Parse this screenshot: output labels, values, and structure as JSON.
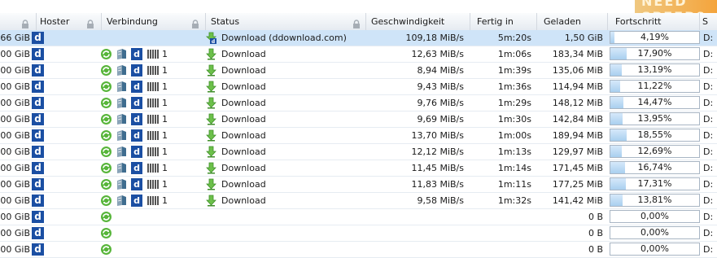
{
  "banner_text": "NEED SPEED?",
  "columns": {
    "hoster": "Hoster",
    "verbindung": "Verbindung",
    "status": "Status",
    "geschwindigkeit": "Geschwindigkeit",
    "fertig_in": "Fertig in",
    "geladen": "Geladen",
    "fortschritt": "Fortschritt",
    "last": "S"
  },
  "rows": [
    {
      "size": "66 GiB",
      "hoster": "d",
      "connections": "",
      "status": "Download (ddownload.com)",
      "speed": "109,18 MiB/s",
      "eta": "5m:20s",
      "loaded": "1,50 GiB",
      "progress": "4,19%",
      "progress_value": 4.19,
      "last": "D:",
      "selected": true
    },
    {
      "size": "00 GiB",
      "hoster": "d",
      "connections": "1",
      "status": "Download",
      "speed": "12,63 MiB/s",
      "eta": "1m:06s",
      "loaded": "183,34 MiB",
      "progress": "17,90%",
      "progress_value": 17.9,
      "last": "D:"
    },
    {
      "size": "00 GiB",
      "hoster": "d",
      "connections": "1",
      "status": "Download",
      "speed": "8,94 MiB/s",
      "eta": "1m:39s",
      "loaded": "135,06 MiB",
      "progress": "13,19%",
      "progress_value": 13.19,
      "last": "D:"
    },
    {
      "size": "00 GiB",
      "hoster": "d",
      "connections": "1",
      "status": "Download",
      "speed": "9,43 MiB/s",
      "eta": "1m:36s",
      "loaded": "114,94 MiB",
      "progress": "11,22%",
      "progress_value": 11.22,
      "last": "D:"
    },
    {
      "size": "00 GiB",
      "hoster": "d",
      "connections": "1",
      "status": "Download",
      "speed": "9,76 MiB/s",
      "eta": "1m:29s",
      "loaded": "148,12 MiB",
      "progress": "14,47%",
      "progress_value": 14.47,
      "last": "D:"
    },
    {
      "size": "00 GiB",
      "hoster": "d",
      "connections": "1",
      "status": "Download",
      "speed": "9,69 MiB/s",
      "eta": "1m:30s",
      "loaded": "142,84 MiB",
      "progress": "13,95%",
      "progress_value": 13.95,
      "last": "D:"
    },
    {
      "size": "00 GiB",
      "hoster": "d",
      "connections": "1",
      "status": "Download",
      "speed": "13,70 MiB/s",
      "eta": "1m:00s",
      "loaded": "189,94 MiB",
      "progress": "18,55%",
      "progress_value": 18.55,
      "last": "D:"
    },
    {
      "size": "00 GiB",
      "hoster": "d",
      "connections": "1",
      "status": "Download",
      "speed": "12,12 MiB/s",
      "eta": "1m:13s",
      "loaded": "129,97 MiB",
      "progress": "12,69%",
      "progress_value": 12.69,
      "last": "D:"
    },
    {
      "size": "00 GiB",
      "hoster": "d",
      "connections": "1",
      "status": "Download",
      "speed": "11,45 MiB/s",
      "eta": "1m:14s",
      "loaded": "171,45 MiB",
      "progress": "16,74%",
      "progress_value": 16.74,
      "last": "D:"
    },
    {
      "size": "00 GiB",
      "hoster": "d",
      "connections": "1",
      "status": "Download",
      "speed": "11,83 MiB/s",
      "eta": "1m:11s",
      "loaded": "177,25 MiB",
      "progress": "17,31%",
      "progress_value": 17.31,
      "last": "D:"
    },
    {
      "size": "00 GiB",
      "hoster": "d",
      "connections": "1",
      "status": "Download",
      "speed": "9,58 MiB/s",
      "eta": "1m:32s",
      "loaded": "141,42 MiB",
      "progress": "13,81%",
      "progress_value": 13.81,
      "last": "D:"
    },
    {
      "size": "00 GiB",
      "hoster": "d",
      "connections": "",
      "status": "",
      "speed": "",
      "eta": "",
      "loaded": "0 B",
      "progress": "0,00%",
      "progress_value": 0,
      "last": "D:",
      "idle": true
    },
    {
      "size": "00 GiB",
      "hoster": "d",
      "connections": "",
      "status": "",
      "speed": "",
      "eta": "",
      "loaded": "0 B",
      "progress": "0,00%",
      "progress_value": 0,
      "last": "D:",
      "idle": true
    },
    {
      "size": "00 GiB",
      "hoster": "d",
      "connections": "",
      "status": "",
      "speed": "",
      "eta": "",
      "loaded": "0 B",
      "progress": "0,00%",
      "progress_value": 0,
      "last": "D:",
      "idle": true
    }
  ]
}
